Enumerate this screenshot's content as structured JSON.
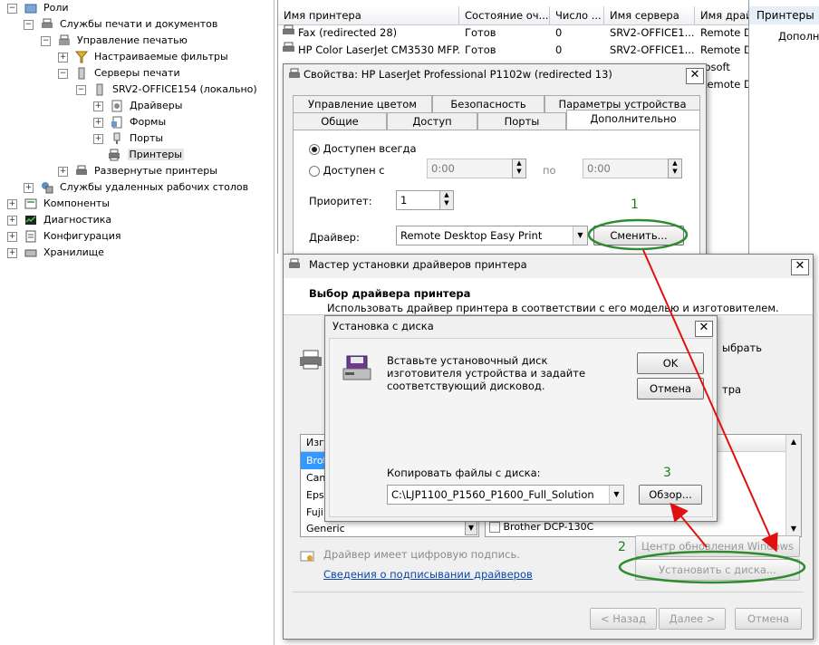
{
  "tree": {
    "items": [
      {
        "label": "Роли",
        "expander": "−"
      },
      {
        "label": "Службы печати и документов",
        "expander": "−"
      },
      {
        "label": "Управление печатью",
        "expander": "−"
      },
      {
        "label": "Настраиваемые фильтры",
        "expander": "+"
      },
      {
        "label": "Серверы печати",
        "expander": "−"
      },
      {
        "label": "SRV2-OFFICE154 (локально)",
        "expander": "−"
      },
      {
        "label": "Драйверы",
        "expander": "+"
      },
      {
        "label": "Формы",
        "expander": "+"
      },
      {
        "label": "Порты",
        "expander": "+"
      },
      {
        "label": "Принтеры",
        "expander": ""
      },
      {
        "label": "Развернутые принтеры",
        "expander": "+"
      },
      {
        "label": "Службы удаленных рабочих столов",
        "expander": "+"
      },
      {
        "label": "Компоненты",
        "expander": "+"
      },
      {
        "label": "Диагностика",
        "expander": "+"
      },
      {
        "label": "Конфигурация",
        "expander": "+"
      },
      {
        "label": "Хранилище",
        "expander": "+"
      }
    ]
  },
  "printer_list": {
    "columns": [
      "Имя принтера",
      "Состояние оч...",
      "Число ...",
      "Имя сервера",
      "Имя драй"
    ],
    "rows": [
      {
        "name": "Fax (redirected 28)",
        "status": "Готов",
        "jobs": "0",
        "server": "SRV2-OFFICE1...",
        "driver": "Remote D"
      },
      {
        "name": "HP Color LaserJet CM3530 MFP...",
        "status": "Готов",
        "jobs": "0",
        "server": "SRV2-OFFICE1...",
        "driver": "Remote D"
      }
    ],
    "overflow_driver_1": "rosoft",
    "overflow_driver_2": "Remote D"
  },
  "right_pane": {
    "title": "Принтеры",
    "action": "Дополн"
  },
  "props_dialog": {
    "title": "Свойства: HP LaserJet Professional P1102w (redirected 13)",
    "tabs_row1": [
      "Управление цветом",
      "Безопасность",
      "Параметры устройства"
    ],
    "tabs_row2": [
      "Общие",
      "Доступ",
      "Порты",
      "Дополнительно"
    ],
    "always_label": "Доступен всегда",
    "from_label": "Доступен с",
    "to_label": "по",
    "time_from": "0:00",
    "time_to": "0:00",
    "priority_label": "Приоритет:",
    "priority_value": "1",
    "driver_label": "Драйвер:",
    "driver_value": "Remote Desktop Easy Print",
    "change_button": "Сменить..."
  },
  "wizard": {
    "title": "Мастер установки драйверов принтера",
    "heading": "Выбор драйвера принтера",
    "subheading": "Использовать драйвер принтера в соответствии с его моделью и изготовителем.",
    "right_text_1": "ыбрать",
    "right_text_2": "тра",
    "mfr_header": "Изг",
    "manufacturers": [
      "Brot",
      "Can",
      "Eps",
      "Fuji",
      "Generic"
    ],
    "model_item": "Brother DCP-130C",
    "signed_text": "Драйвер имеет цифровую подпись.",
    "signing_link": "Сведения о подписывании драйверов",
    "update_button": "Центр обновления Windows",
    "have_disk_button": "Установить с диска...",
    "back_button": "< Назад",
    "next_button": "Далее >",
    "cancel_button": "Отмена"
  },
  "install_dialog": {
    "title": "Установка с диска",
    "message": "Вставьте установочный диск изготовителя устройства и задайте соответствующий дисковод.",
    "ok_button": "OK",
    "cancel_button": "Отмена",
    "copy_label": "Копировать файлы с диска:",
    "path_value": "C:\\LJP1100_P1560_P1600_Full_Solution",
    "browse_button": "Обзор..."
  },
  "annotations": {
    "step1": "1",
    "step2": "2",
    "step3": "3"
  },
  "colors": {
    "annotation_green": "#2e8b2e",
    "annotation_red": "#e01010",
    "link": "#0c47a8"
  }
}
